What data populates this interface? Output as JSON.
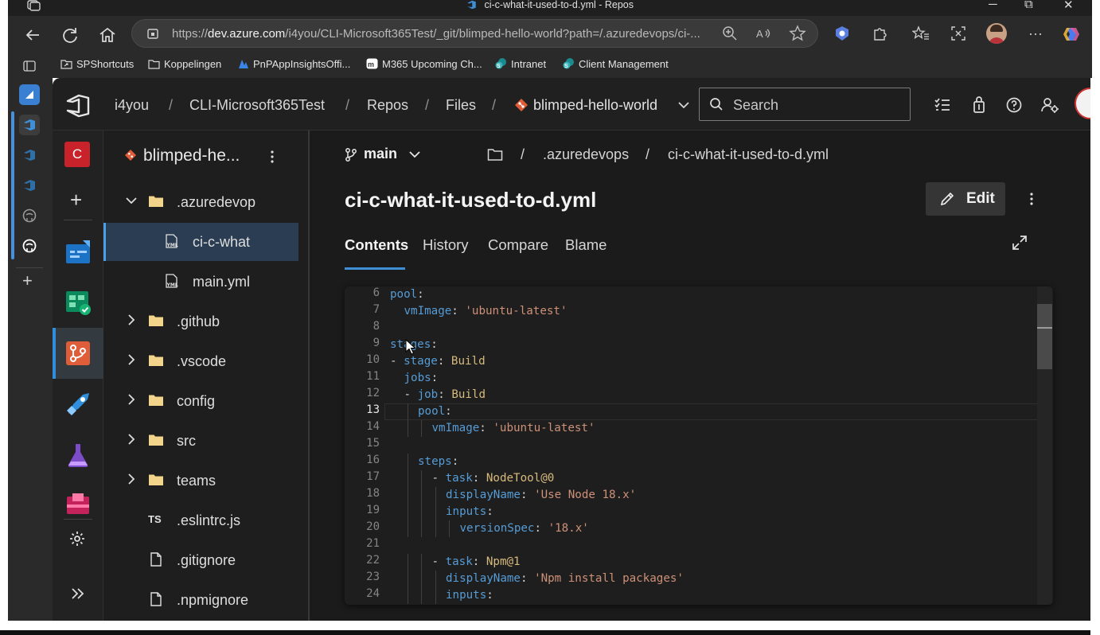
{
  "window": {
    "title": "ci-c-what-it-used-to-d.yml - Repos",
    "controls": [
      "─",
      "⧉",
      "✕"
    ]
  },
  "browser": {
    "url_prefix": "https://",
    "url_host": "dev.azure.com",
    "url_path": "/i4you/CLI-Microsoft365Test/_git/blimped-hello-world?path=/.azuredevops/ci-..."
  },
  "favorites": [
    {
      "label": "SPShortcuts",
      "icon": "shortcut-folder-icon"
    },
    {
      "label": "Koppelingen",
      "icon": "folder-icon"
    },
    {
      "label": "PnPAppInsightsOffi...",
      "icon": "pnp-icon"
    },
    {
      "label": "M365 Upcoming Ch...",
      "icon": "m365-icon"
    },
    {
      "label": "Intranet",
      "icon": "sharepoint-icon"
    },
    {
      "label": "Client Management",
      "icon": "sharepoint-icon"
    }
  ],
  "topnav": {
    "org": "i4you",
    "project": "CLI-Microsoft365Test",
    "repos": "Repos",
    "files": "Files",
    "repo": "blimped-hello-world",
    "sep": "/",
    "search_placeholder": "Search"
  },
  "rail": {
    "avatar_letter": "C"
  },
  "tree": {
    "repo_title": "blimped-he...",
    "items": [
      {
        "label": ".azuredevop",
        "type": "folder",
        "expanded": true,
        "level": 0
      },
      {
        "label": "ci-c-what",
        "type": "yml",
        "level": 1,
        "selected": true
      },
      {
        "label": "main.yml",
        "type": "yml",
        "level": 1
      },
      {
        "label": ".github",
        "type": "folder",
        "level": 0
      },
      {
        "label": ".vscode",
        "type": "folder",
        "level": 0
      },
      {
        "label": "config",
        "type": "folder",
        "level": 0
      },
      {
        "label": "src",
        "type": "folder",
        "level": 0
      },
      {
        "label": "teams",
        "type": "folder",
        "level": 0
      },
      {
        "label": ".eslintrc.js",
        "type": "ts",
        "level": 0,
        "ts_label": "TS"
      },
      {
        "label": ".gitignore",
        "type": "file",
        "level": 0
      },
      {
        "label": ".npmignore",
        "type": "file",
        "level": 0
      }
    ]
  },
  "content": {
    "branch": "main",
    "path": [
      ".azuredevops",
      "ci-c-what-it-used-to-d.yml"
    ],
    "sep": "/",
    "file_title": "ci-c-what-it-used-to-d.yml",
    "edit_label": "Edit",
    "tabs": [
      "Contents",
      "History",
      "Compare",
      "Blame"
    ],
    "active_tab": "Contents"
  },
  "code": {
    "current_line": 13,
    "lines": [
      {
        "n": "6",
        "indent": 0,
        "parts": [
          [
            "k",
            "pool"
          ],
          [
            "p",
            ":"
          ]
        ]
      },
      {
        "n": "7",
        "indent": 1,
        "parts": [
          [
            "k",
            "vmImage"
          ],
          [
            "p",
            ": "
          ],
          [
            "s",
            "'ubuntu-latest'"
          ]
        ]
      },
      {
        "n": "8",
        "indent": 0,
        "parts": []
      },
      {
        "n": "9",
        "indent": 0,
        "parts": [
          [
            "k",
            "stages"
          ],
          [
            "p",
            ":"
          ]
        ]
      },
      {
        "n": "10",
        "indent": 0,
        "parts": [
          [
            "p",
            "- "
          ],
          [
            "k",
            "stage"
          ],
          [
            "p",
            ": "
          ],
          [
            "v",
            "Build"
          ]
        ]
      },
      {
        "n": "11",
        "indent": 1,
        "parts": [
          [
            "k",
            "jobs"
          ],
          [
            "p",
            ":"
          ]
        ]
      },
      {
        "n": "12",
        "indent": 1,
        "parts": [
          [
            "p",
            "- "
          ],
          [
            "k",
            "job"
          ],
          [
            "p",
            ": "
          ],
          [
            "v",
            "Build"
          ]
        ]
      },
      {
        "n": "13",
        "indent": 2,
        "parts": [
          [
            "k",
            "pool"
          ],
          [
            "p",
            ":"
          ]
        ]
      },
      {
        "n": "14",
        "indent": 3,
        "parts": [
          [
            "k",
            "vmImage"
          ],
          [
            "p",
            ": "
          ],
          [
            "s",
            "'ubuntu-latest'"
          ]
        ]
      },
      {
        "n": "15",
        "indent": 0,
        "parts": []
      },
      {
        "n": "16",
        "indent": 2,
        "parts": [
          [
            "k",
            "steps"
          ],
          [
            "p",
            ":"
          ]
        ]
      },
      {
        "n": "17",
        "indent": 3,
        "parts": [
          [
            "p",
            "- "
          ],
          [
            "k",
            "task"
          ],
          [
            "p",
            ": "
          ],
          [
            "v",
            "NodeTool@0"
          ]
        ]
      },
      {
        "n": "18",
        "indent": 4,
        "parts": [
          [
            "k",
            "displayName"
          ],
          [
            "p",
            ": "
          ],
          [
            "s",
            "'Use Node 18.x'"
          ]
        ]
      },
      {
        "n": "19",
        "indent": 4,
        "parts": [
          [
            "k",
            "inputs"
          ],
          [
            "p",
            ":"
          ]
        ]
      },
      {
        "n": "20",
        "indent": 5,
        "parts": [
          [
            "k",
            "versionSpec"
          ],
          [
            "p",
            ": "
          ],
          [
            "s",
            "'18.x'"
          ]
        ]
      },
      {
        "n": "21",
        "indent": 0,
        "parts": []
      },
      {
        "n": "22",
        "indent": 3,
        "parts": [
          [
            "p",
            "- "
          ],
          [
            "k",
            "task"
          ],
          [
            "p",
            ": "
          ],
          [
            "v",
            "Npm@1"
          ]
        ]
      },
      {
        "n": "23",
        "indent": 4,
        "parts": [
          [
            "k",
            "displayName"
          ],
          [
            "p",
            ": "
          ],
          [
            "s",
            "'Npm install packages'"
          ]
        ]
      },
      {
        "n": "24",
        "indent": 4,
        "parts": [
          [
            "k",
            "inputs"
          ],
          [
            "p",
            ":"
          ]
        ]
      }
    ]
  },
  "colors": {
    "accent": "#3e8fd6",
    "key": "#569cd6",
    "string": "#ce9178",
    "value": "#d7ba7d"
  }
}
